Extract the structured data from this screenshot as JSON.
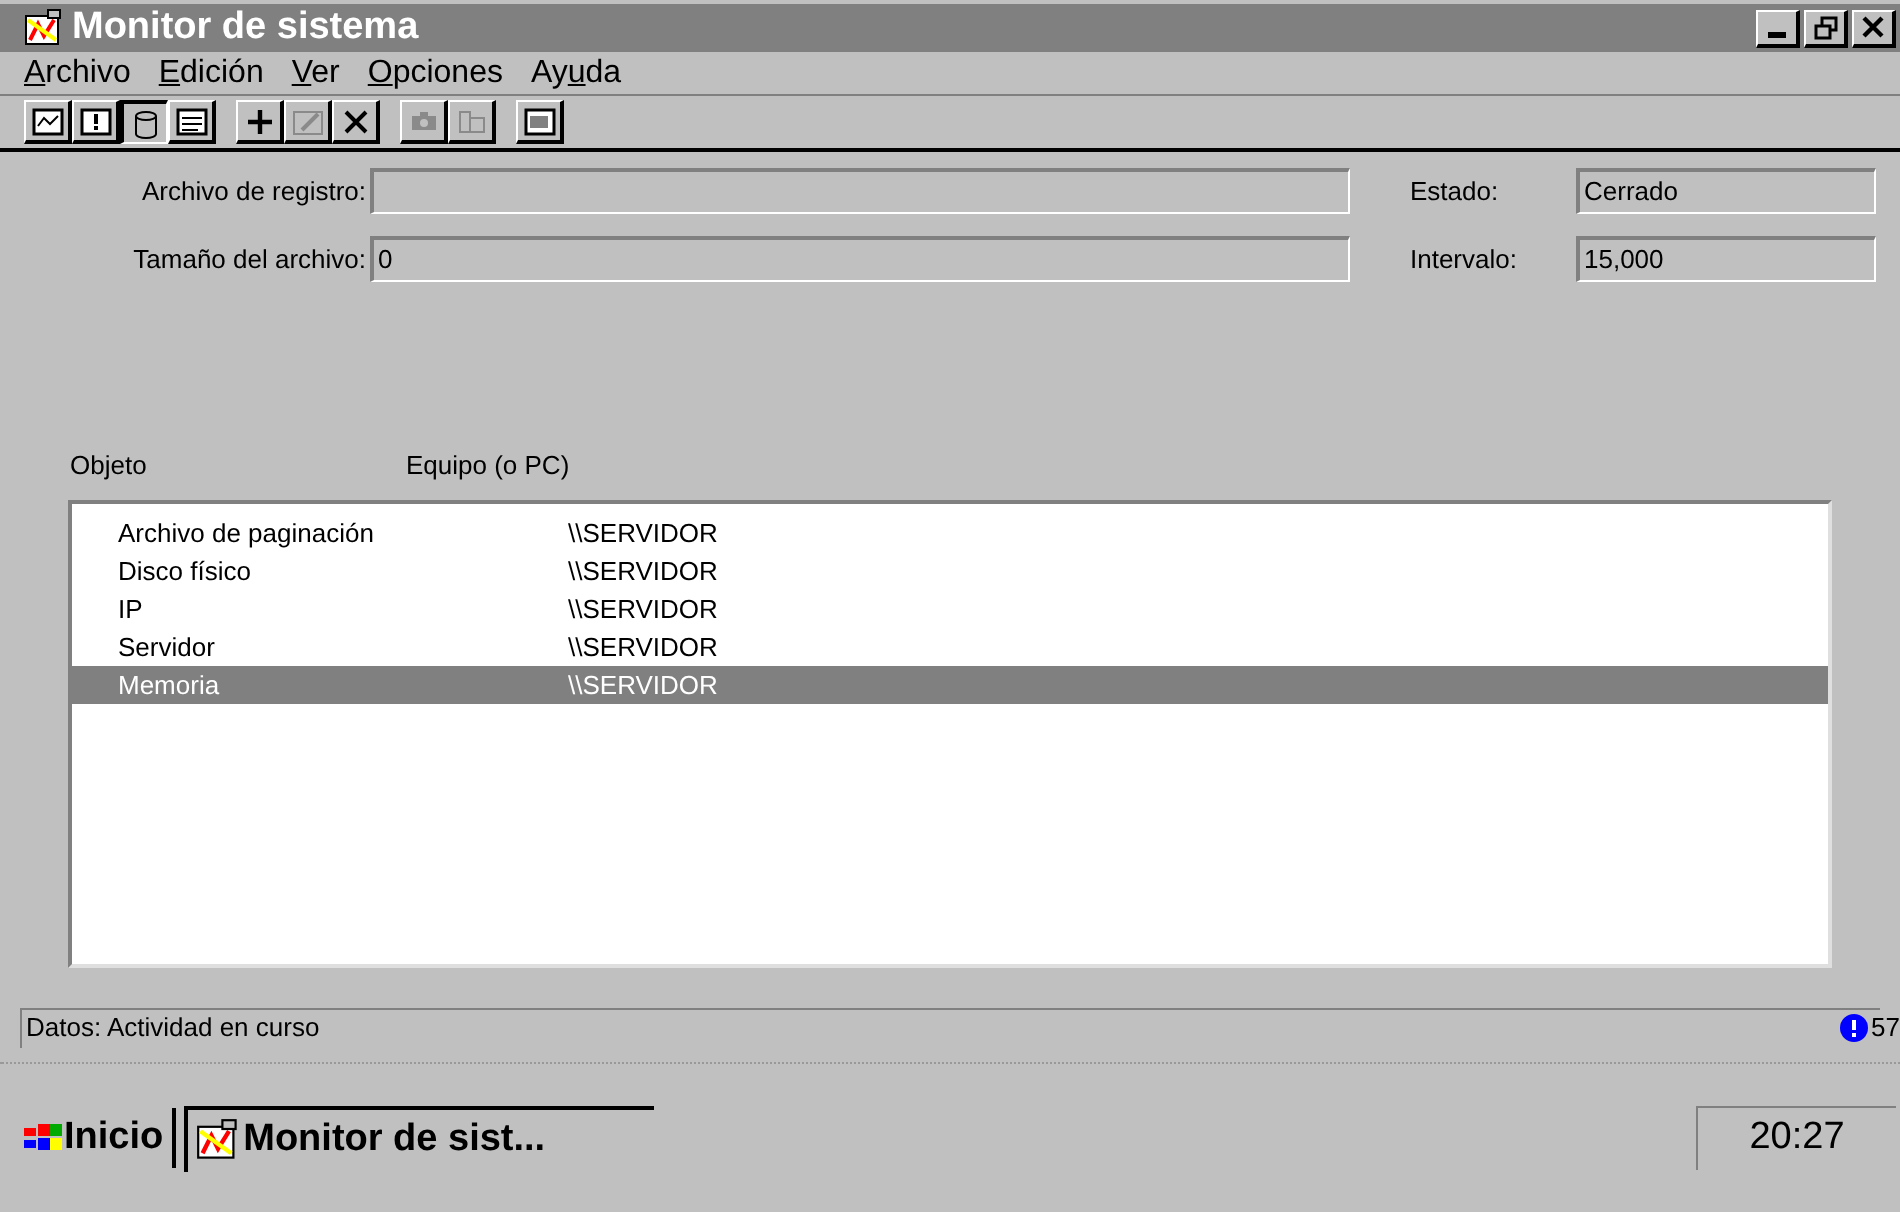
{
  "window": {
    "title": "Monitor de sistema"
  },
  "menu": [
    {
      "mnemonic": "A",
      "after": "rchivo"
    },
    {
      "mnemonic": "E",
      "after": "dición"
    },
    {
      "mnemonic": "V",
      "after": "er"
    },
    {
      "mnemonic": "O",
      "after": "pciones"
    },
    {
      "before": "Ay",
      "mnemonic": "u",
      "after": "da"
    }
  ],
  "toolbar": [
    [
      {
        "kind": "chart",
        "selected": false,
        "disabled": false
      },
      {
        "kind": "alert",
        "selected": false,
        "disabled": false
      },
      {
        "kind": "log",
        "selected": true,
        "disabled": false
      },
      {
        "kind": "report",
        "selected": false,
        "disabled": false
      }
    ],
    [
      {
        "kind": "add",
        "selected": false,
        "disabled": false
      },
      {
        "kind": "edit",
        "selected": false,
        "disabled": true
      },
      {
        "kind": "delete",
        "selected": false,
        "disabled": false
      }
    ],
    [
      {
        "kind": "camera",
        "selected": false,
        "disabled": true
      },
      {
        "kind": "bookmark",
        "selected": false,
        "disabled": true
      }
    ],
    [
      {
        "kind": "options",
        "selected": false,
        "disabled": false
      }
    ]
  ],
  "form": {
    "log_file": {
      "label": "Archivo de registro:"
    },
    "file_size": {
      "label": "Tamaño del archivo:",
      "value": "0"
    },
    "state": {
      "label": "Estado:",
      "value": "Cerrado"
    },
    "interval": {
      "label": "Intervalo:",
      "value": "15,000"
    }
  },
  "list": {
    "columns": [
      "Objeto",
      "Equipo (o PC)"
    ],
    "rows": [
      {
        "cells": [
          "Archivo de paginación",
          "\\\\SERVIDOR"
        ],
        "selected": false
      },
      {
        "cells": [
          "Disco físico",
          "\\\\SERVIDOR"
        ],
        "selected": false
      },
      {
        "cells": [
          "IP",
          "\\\\SERVIDOR"
        ],
        "selected": false
      },
      {
        "cells": [
          "Servidor",
          "\\\\SERVIDOR"
        ],
        "selected": false
      },
      {
        "cells": [
          "Memoria",
          "\\\\SERVIDOR"
        ],
        "selected": true
      }
    ]
  },
  "status_bar": {
    "text": "Datos: Actividad en curso",
    "counter": "57"
  },
  "taskbar": {
    "start": "Inicio",
    "task": "Monitor de sist...",
    "clock": "20:27"
  }
}
